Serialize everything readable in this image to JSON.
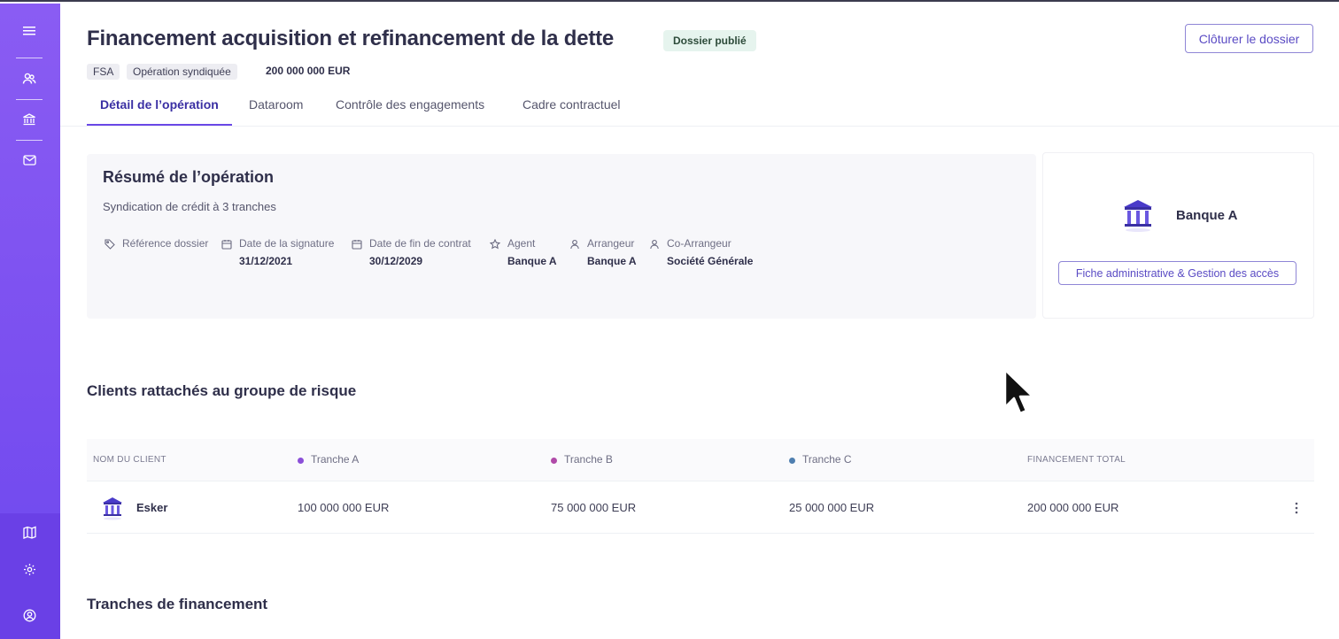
{
  "header": {
    "title": "Financement acquisition et refinancement de la dette",
    "status": "Dossier publié",
    "close_button": "Clôturer le dossier",
    "tags": [
      "FSA",
      "Opération syndiquée"
    ],
    "amount": "200 000 000 EUR"
  },
  "tabs": [
    {
      "label": "Détail de l’opération",
      "active": true
    },
    {
      "label": "Dataroom",
      "active": false
    },
    {
      "label": "Contrôle des engagements",
      "active": false
    },
    {
      "label": "Cadre contractuel",
      "active": false
    }
  ],
  "summary": {
    "title": "Résumé de l’opération",
    "subtitle": "Syndication de crédit à 3 tranches",
    "fields": [
      {
        "label": "Référence dossier",
        "value": "",
        "icon": "tag-icon"
      },
      {
        "label": "Date de la signature",
        "value": "31/12/2021",
        "icon": "calendar-icon"
      },
      {
        "label": "Date de fin de contrat",
        "value": "30/12/2029",
        "icon": "calendar-icon"
      },
      {
        "label": "Agent",
        "value": "Banque A",
        "icon": "star-icon"
      },
      {
        "label": "Arrangeur",
        "value": "Banque A",
        "icon": "user-icon"
      },
      {
        "label": "Co-Arrangeur",
        "value": "Société Générale",
        "icon": "user-icon"
      }
    ]
  },
  "bank_card": {
    "name": "Banque A",
    "button": "Fiche administrative & Gestion des accès"
  },
  "clients": {
    "title": "Clients rattachés au groupe de risque",
    "headers": {
      "client": "NOM DU CLIENT",
      "tranche_a": "Tranche A",
      "tranche_b": "Tranche B",
      "tranche_c": "Tranche C",
      "total": "FINANCEMENT TOTAL"
    },
    "dot_colors": {
      "tranche_a": "#8b4fd8",
      "tranche_b": "#b04aa8",
      "tranche_c": "#4f7fb0"
    },
    "rows": [
      {
        "name": "Esker",
        "tranche_a": "100 000 000 EUR",
        "tranche_b": "75 000 000 EUR",
        "tranche_c": "25 000 000 EUR",
        "total": "200 000 000 EUR"
      }
    ]
  },
  "tranches": {
    "title": "Tranches de financement"
  },
  "colors": {
    "accent": "#6a48e6",
    "sidebar": "#7a4ff0",
    "badge_bg": "#e6f4ee"
  }
}
